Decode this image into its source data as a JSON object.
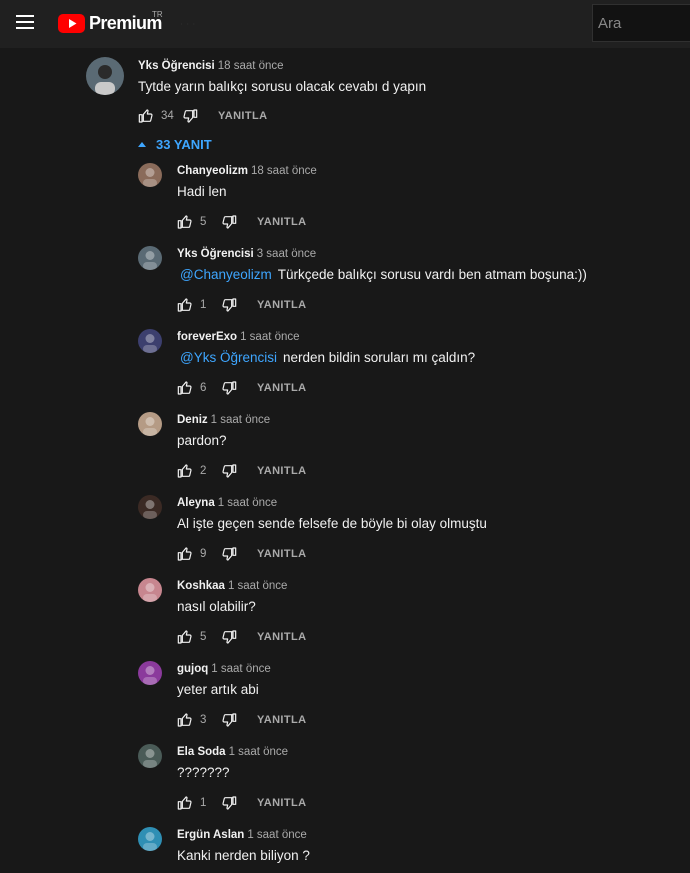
{
  "header": {
    "logo_text": "Premium",
    "country": "TR",
    "search_placeholder": "Ara",
    "faint_text": "∙ ∙ ∙"
  },
  "top_comment": {
    "author": "Yks Öğrencisi",
    "time": "18 saat önce",
    "text": "Tytde yarın balıkçı sorusu olacak cevabı d yapın",
    "likes": "34",
    "reply_label": "YANITLA",
    "avatar_color": "#5a6a74"
  },
  "replies_toggle": "33 YANIT",
  "replies": [
    {
      "author": "Chanyeolizm",
      "time": "18 saat önce",
      "mention": "",
      "text": "Hadi len",
      "likes": "5",
      "reply_label": "YANITLA",
      "avatar_color": "#8a6b5a"
    },
    {
      "author": "Yks Öğrencisi",
      "time": "3 saat önce",
      "mention": "@Chanyeolizm",
      "text": "Türkçede balıkçı sorusu vardı ben atmam boşuna:))",
      "likes": "1",
      "reply_label": "YANITLA",
      "avatar_color": "#5a6a74"
    },
    {
      "author": "foreverExo",
      "time": "1 saat önce",
      "mention": "@Yks Öğrencisi",
      "text": "nerden bildin soruları mı çaldın?",
      "likes": "6",
      "reply_label": "YANITLA",
      "avatar_color": "#3c3f6e"
    },
    {
      "author": "Deniz",
      "time": "1 saat önce",
      "mention": "",
      "text": "pardon?",
      "likes": "2",
      "reply_label": "YANITLA",
      "avatar_color": "#b59b85"
    },
    {
      "author": "Aleyna",
      "time": "1 saat önce",
      "mention": "",
      "text": "Al işte geçen sende felsefe de böyle bi olay olmuştu",
      "likes": "9",
      "reply_label": "YANITLA",
      "avatar_color": "#3b2a24"
    },
    {
      "author": "Koshkaa",
      "time": "1 saat önce",
      "mention": "",
      "text": "nasıl olabilir?",
      "likes": "5",
      "reply_label": "YANITLA",
      "avatar_color": "#c7868f"
    },
    {
      "author": "gujoq",
      "time": "1 saat önce",
      "mention": "",
      "text": "yeter artık abi",
      "likes": "3",
      "reply_label": "YANITLA",
      "avatar_color": "#8b3a9c"
    },
    {
      "author": "Ela Soda",
      "time": "1 saat önce",
      "mention": "",
      "text": "???????",
      "likes": "1",
      "reply_label": "YANITLA",
      "avatar_color": "#4a5b57"
    },
    {
      "author": "Ergün Aslan",
      "time": "1 saat önce",
      "mention": "",
      "text": "Kanki nerden biliyon ?",
      "likes": "",
      "reply_label": "",
      "avatar_color": "#2f8fb4"
    }
  ]
}
